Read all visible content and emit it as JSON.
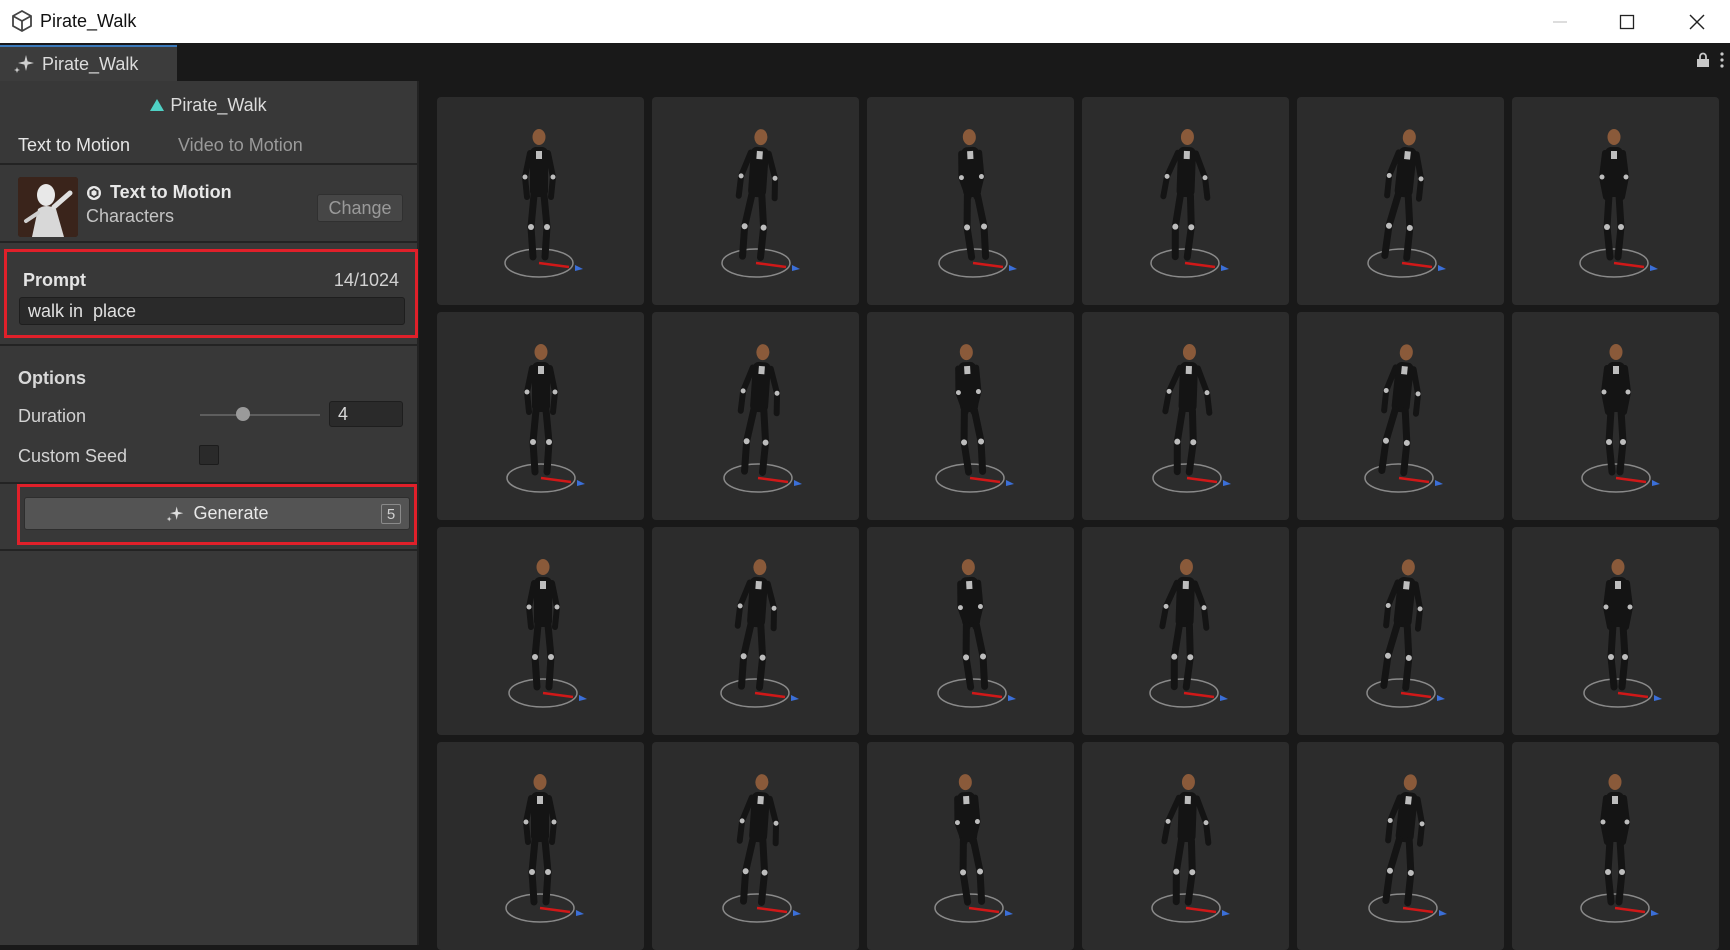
{
  "window": {
    "title": "Pirate_Walk",
    "icons": {
      "app": "unity-cube-icon",
      "minimize": "minimize-icon",
      "maximize": "maximize-icon",
      "close": "close-icon"
    }
  },
  "tab": {
    "label": "Pirate_Walk",
    "icon": "sparkle-icon"
  },
  "asset": {
    "name": "Pirate_Walk",
    "icon": "animation-clip-icon"
  },
  "modes": {
    "text_to_motion": "Text to Motion",
    "video_to_motion": "Video to Motion",
    "active": "Text to Motion"
  },
  "model": {
    "name": "Text to Motion",
    "category": "Characters",
    "change_label": "Change"
  },
  "prompt": {
    "label": "Prompt",
    "count": "14/1024",
    "value": "walk in  place"
  },
  "options": {
    "label": "Options",
    "duration_label": "Duration",
    "duration_value": "4",
    "custom_seed_label": "Custom Seed",
    "custom_seed_checked": false
  },
  "generate": {
    "label": "Generate",
    "count": "5"
  },
  "results": {
    "count": 24
  },
  "colors": {
    "highlight": "#e0202a",
    "accent": "#3a79bb"
  }
}
